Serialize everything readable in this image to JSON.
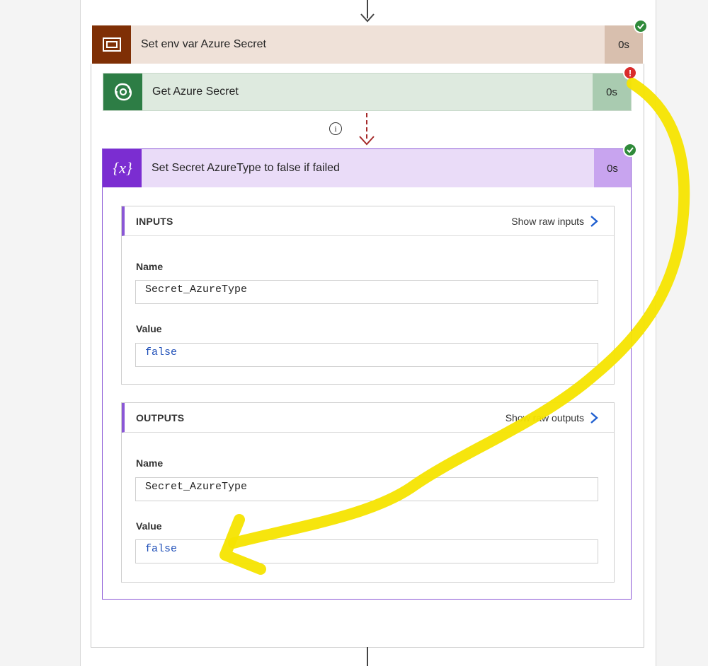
{
  "actions": {
    "set_env": {
      "title": "Set env var Azure Secret",
      "duration": "0s",
      "status": "succeeded"
    },
    "get_secret": {
      "title": "Get Azure Secret",
      "duration": "0s",
      "status": "failed"
    },
    "set_secret": {
      "title": "Set Secret AzureType to false if failed",
      "duration": "0s",
      "status": "succeeded"
    }
  },
  "inputs": {
    "header": "INPUTS",
    "raw_link": "Show raw inputs",
    "name_label": "Name",
    "name_value": "Secret_AzureType",
    "value_label": "Value",
    "value_value": "false"
  },
  "outputs": {
    "header": "OUTPUTS",
    "raw_link": "Show raw outputs",
    "name_label": "Name",
    "name_value": "Secret_AzureType",
    "value_label": "Value",
    "value_value": "false"
  },
  "icons": {
    "set_env_icon": "variable-box-icon",
    "get_secret_icon": "dataverse-icon",
    "set_secret_icon": "variable-x-icon",
    "success": "check-circle-icon",
    "error": "error-circle-icon",
    "info": "info-icon",
    "chevron": "chevron-right-icon"
  },
  "colors": {
    "set_env_accent": "#7f2f05",
    "set_env_bg": "#efe1d8",
    "get_secret_accent": "#2d7d45",
    "get_secret_bg": "#deeadf",
    "set_secret_accent": "#7b2dd1",
    "set_secret_bg": "#eadcf8",
    "success": "#2f8a3a",
    "error": "#d92c2c",
    "annotation": "#f5e400"
  }
}
